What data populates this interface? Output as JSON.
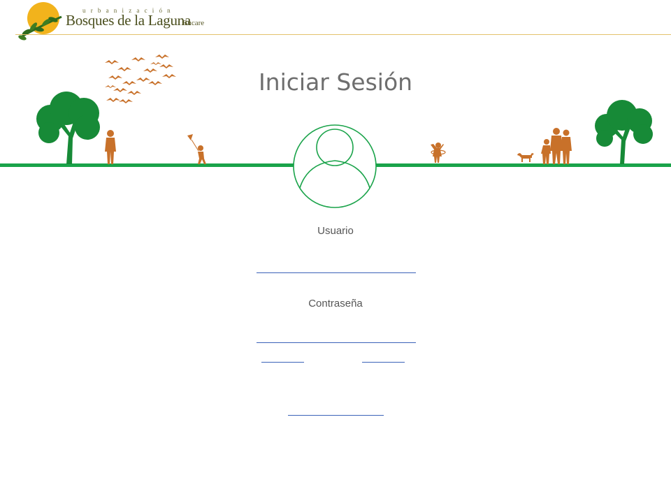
{
  "header": {
    "logo": {
      "line1": "urbanización",
      "line2": "Bosques de la Laguna"
    },
    "tag": "Bucare"
  },
  "page": {
    "title": "Iniciar Sesión"
  },
  "form": {
    "user_label": "Usuario",
    "user_value": "",
    "password_label": "Contraseña",
    "password_value": ""
  },
  "icons": {
    "avatar": "user-avatar-icon",
    "trees": "tree-icon",
    "birds": "birds-icon",
    "people": "people-icon",
    "dog": "dog-icon"
  },
  "colors": {
    "green": "#1aa34a",
    "tree": "#178a37",
    "orange": "#c8712a",
    "link": "#3a62b8",
    "title": "#6e6e6e"
  }
}
